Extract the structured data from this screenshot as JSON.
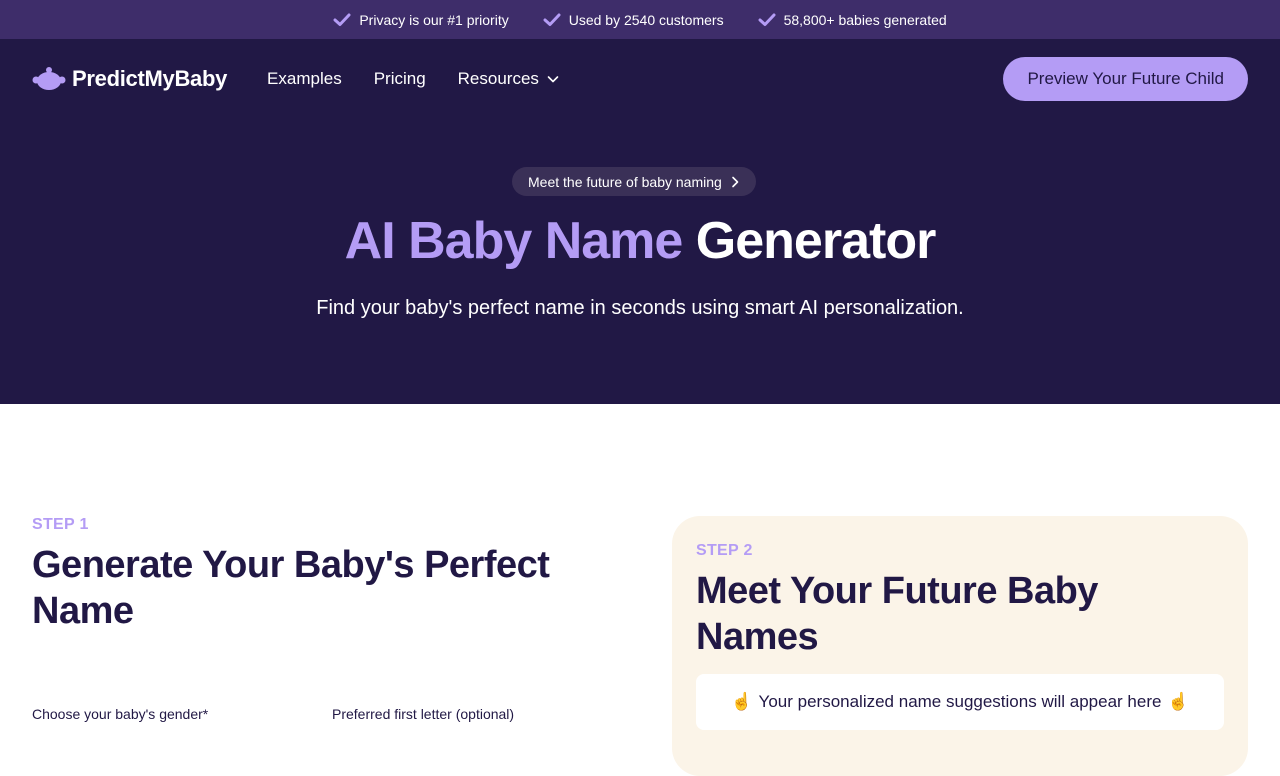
{
  "topbar": {
    "items": [
      {
        "label": "Privacy is our #1 priority",
        "icon": "check-icon"
      },
      {
        "label": "Used by 2540 customers",
        "icon": "check-icon"
      },
      {
        "label": "58,800+ babies generated",
        "icon": "check-icon"
      }
    ]
  },
  "nav": {
    "logo_text": "PredictMyBaby",
    "links": {
      "examples": "Examples",
      "pricing": "Pricing",
      "resources": "Resources"
    },
    "cta_label": "Preview Your Future Child"
  },
  "hero": {
    "pill_text": "Meet the future of baby naming",
    "title_accent": "AI Baby Name",
    "title_rest": "Generator",
    "subtitle": "Find your baby's perfect name in seconds using smart AI personalization."
  },
  "step1": {
    "label": "STEP 1",
    "title": "Generate Your Baby's Perfect Name",
    "field_gender_label": "Choose your baby's gender*",
    "field_letter_label": "Preferred first letter (optional)"
  },
  "step2": {
    "label": "STEP 2",
    "title": "Meet Your Future Baby Names",
    "placeholder_text": "Your personalized name suggestions will appear here"
  },
  "colors": {
    "topbar_bg": "#3e2d6a",
    "hero_bg": "#211845",
    "accent": "#b49cf5",
    "step2_bg": "#fbf4e8",
    "text_dark": "#211845"
  }
}
